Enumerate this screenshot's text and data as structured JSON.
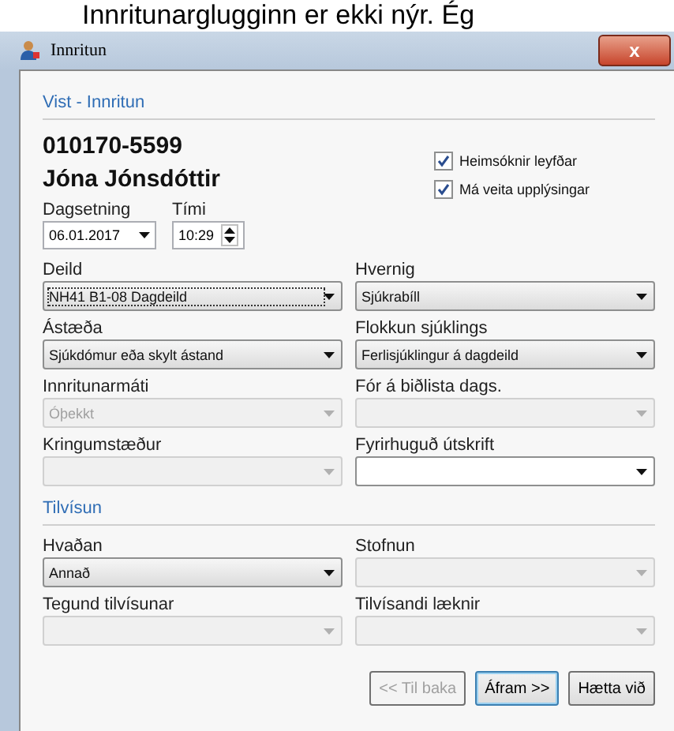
{
  "caption": "Innritunarglugginn er ekki nýr. Ég",
  "window": {
    "title": "Innritun",
    "close": "x"
  },
  "section": "Vist - Innritun",
  "patient": {
    "id": "010170-5599",
    "name": "Jóna Jónsdóttir"
  },
  "checkboxes": [
    {
      "label": "Heimsóknir leyfðar",
      "checked": true
    },
    {
      "label": "Má veita upplýsingar",
      "checked": true
    }
  ],
  "date": {
    "label": "Dagsetning",
    "value": "06.01.2017"
  },
  "time": {
    "label": "Tími",
    "value": "10:29"
  },
  "fields": [
    {
      "label": "Deild",
      "value": "NH41 B1-08 Dagdeild",
      "disabled": false,
      "focused": true
    },
    {
      "label": "Hvernig",
      "value": "Sjúkrabíll",
      "disabled": false,
      "focused": false
    },
    {
      "label": "Ástæða",
      "value": "Sjúkdómur eða skylt ástand",
      "disabled": false,
      "focused": false
    },
    {
      "label": "Flokkun sjúklings",
      "value": "Ferlisjúklingur á dagdeild",
      "disabled": false,
      "focused": false
    },
    {
      "label": "Innritunarmáti",
      "value": "Óþekkt",
      "disabled": true,
      "focused": false
    },
    {
      "label": "Fór á biðlista dags.",
      "disabled": true,
      "focused": false
    },
    {
      "label": "Kringumstæður",
      "disabled": true,
      "focused": false
    },
    {
      "label": "Fyrirhuguð útskrift",
      "disabled": false,
      "focused": false
    }
  ],
  "referral": {
    "title": "Tilvísun",
    "fields": [
      {
        "label": "Hvaðan",
        "value": "Annað",
        "disabled": false,
        "focused": false
      },
      {
        "label": "Stofnun",
        "disabled": true,
        "focused": false
      },
      {
        "label": "Tegund tilvísunar",
        "disabled": true,
        "focused": false
      },
      {
        "label": "Tilvísandi læknir",
        "disabled": true,
        "focused": false
      }
    ]
  },
  "buttons": [
    {
      "label": "<< Til baka",
      "disabled": true,
      "default": false
    },
    {
      "label": "Áfram >>",
      "disabled": false,
      "default": true
    },
    {
      "label": "Hætta við",
      "disabled": false,
      "default": false
    }
  ]
}
